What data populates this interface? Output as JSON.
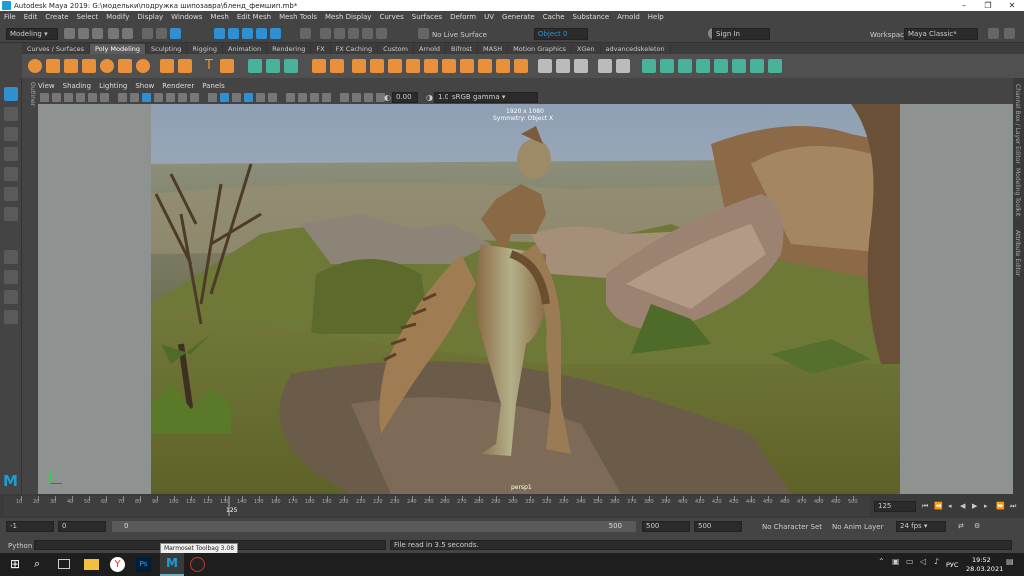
{
  "title": "Autodesk Maya 2019: G:\\модельки\\подружка шипозавра\\бленд_фемшип.mb*",
  "menus": [
    "File",
    "Edit",
    "Create",
    "Select",
    "Modify",
    "Display",
    "Windows",
    "Mesh",
    "Edit Mesh",
    "Mesh Tools",
    "Mesh Display",
    "Curves",
    "Surfaces",
    "Deform",
    "UV",
    "Generate",
    "Cache",
    "Substance",
    "Arnold",
    "Help"
  ],
  "statusline": {
    "menuset": "Modeling",
    "live_surface": "No Live Surface",
    "object_field": "Object 0",
    "sign_in": "Sign In",
    "workspace_label": "Workspace :",
    "workspace_value": "Maya Classic*"
  },
  "shelf_tabs": [
    "Curves / Surfaces",
    "Poly Modeling",
    "Sculpting",
    "Rigging",
    "Animation",
    "Rendering",
    "FX",
    "FX Caching",
    "Custom",
    "Arnold",
    "Bifrost",
    "MASH",
    "Motion Graphics",
    "XGen",
    "advancedskeleton"
  ],
  "shelf_active": "Poly Modeling",
  "panel_menu": [
    "View",
    "Shading",
    "Lighting",
    "Show",
    "Renderer",
    "Panels"
  ],
  "panel_tools": {
    "value1": "0.00",
    "value2": "1.00",
    "colorspace": "sRGB gamma"
  },
  "viewport": {
    "resolution": "1920 x 1080",
    "symmetry": "Symmetry: Object X",
    "camera": "persp1",
    "left_label": "Outliner"
  },
  "right_strip": [
    "Channel Box / Layer Editor",
    "Modeling Toolkit",
    "Attribute Editor"
  ],
  "timeslider": {
    "ticks": [
      "10",
      "20",
      "30",
      "40",
      "50",
      "60",
      "70",
      "80",
      "90",
      "100",
      "110",
      "120",
      "130",
      "140",
      "150",
      "160",
      "170",
      "180",
      "190",
      "200",
      "210",
      "220",
      "230",
      "240",
      "250",
      "260",
      "270",
      "280",
      "290",
      "300",
      "310",
      "320",
      "330",
      "340",
      "350",
      "360",
      "370",
      "380",
      "390",
      "400",
      "410",
      "420",
      "430",
      "440",
      "450",
      "460",
      "470",
      "480",
      "490",
      "500"
    ],
    "current_marker": "125",
    "current_frame": "125"
  },
  "range": {
    "start": "-1",
    "playback_start": "0",
    "bar_start": "0",
    "bar_end": "500",
    "playback_end": "500",
    "end": "500",
    "character_set": "No Character Set",
    "anim_layer": "No Anim Layer",
    "fps": "24 fps"
  },
  "cmdline": {
    "label": "Python",
    "tooltip": "Marmoset Toolbag 3.08",
    "result": "File read in  3.5 seconds."
  },
  "taskbar": {
    "lang": "РУС",
    "time": "19:52",
    "date": "28.03.2021"
  },
  "colors": {
    "accent": "#2f8fd0",
    "maya_blue": "#1a9fd5",
    "shelf_orange": "#e8913a",
    "shelf_green": "#49b29b"
  }
}
